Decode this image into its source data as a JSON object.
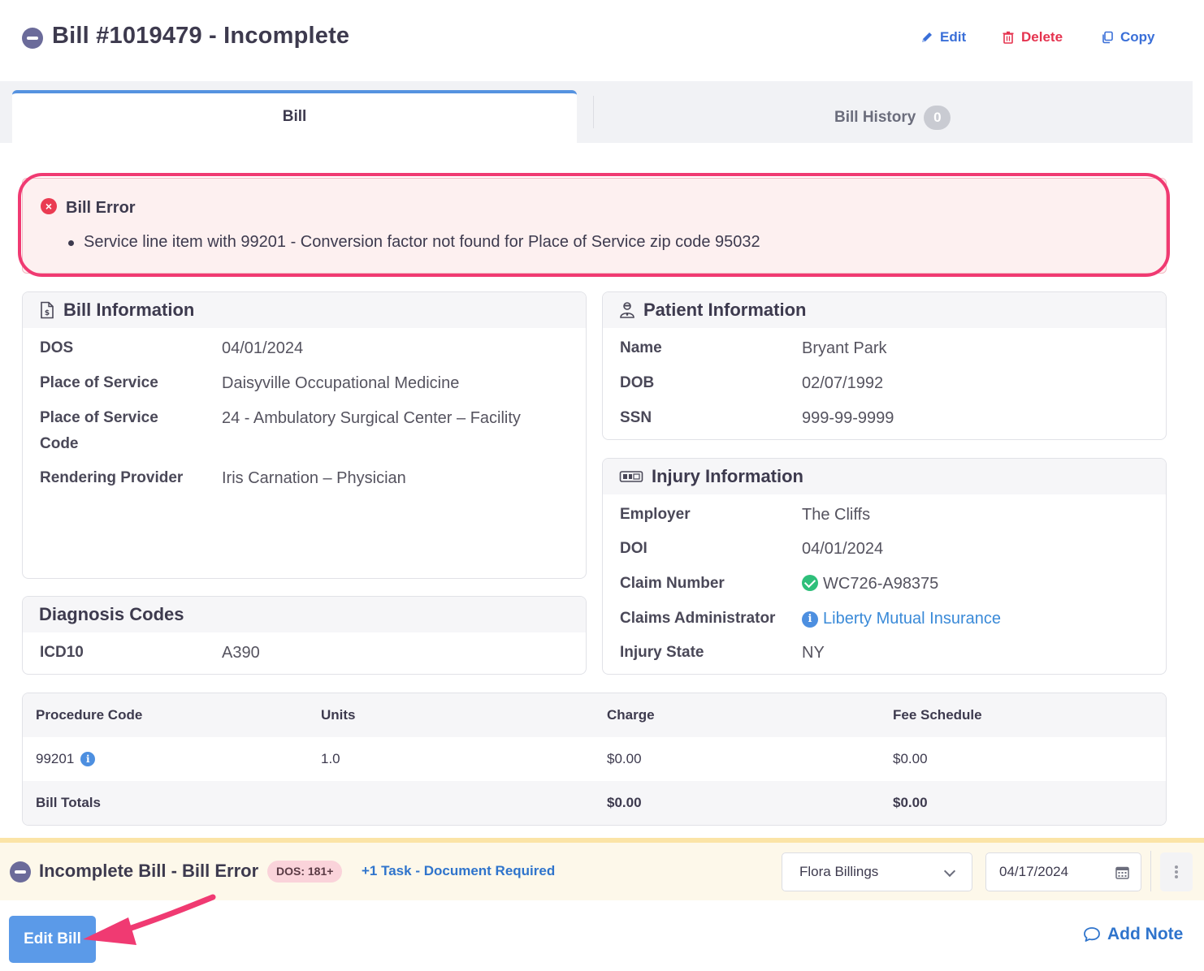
{
  "header": {
    "title": "Bill #1019479 - Incomplete",
    "actions": {
      "edit": "Edit",
      "delete": "Delete",
      "copy": "Copy"
    }
  },
  "tabs": {
    "bill": "Bill",
    "history": "Bill History",
    "history_count": "0"
  },
  "error": {
    "title": "Bill Error",
    "message": "Service line item with 99201 - Conversion factor not found for Place of Service zip code 95032"
  },
  "bill_info": {
    "title": "Bill Information",
    "rows": [
      {
        "label": "DOS",
        "value": "04/01/2024"
      },
      {
        "label": "Place of Service",
        "value": "Daisyville Occupational Medicine"
      },
      {
        "label": "Place of Service",
        "label2": "Code",
        "value": "24 - Ambulatory Surgical Center – Facility"
      },
      {
        "label": "Rendering Provider",
        "value": "Iris Carnation – Physician"
      }
    ]
  },
  "diagnosis": {
    "title": "Diagnosis Codes",
    "label": "ICD10",
    "value": "A390"
  },
  "patient_info": {
    "title": "Patient Information",
    "rows": [
      {
        "label": "Name",
        "value": "Bryant Park"
      },
      {
        "label": "DOB",
        "value": "02/07/1992"
      },
      {
        "label": "SSN",
        "value": "999-99-9999"
      }
    ]
  },
  "injury_info": {
    "title": "Injury Information",
    "rows": [
      {
        "label": "Employer",
        "value": "The Cliffs"
      },
      {
        "label": "DOI",
        "value": "04/01/2024"
      },
      {
        "label": "Claim Number",
        "value": "WC726-A98375"
      },
      {
        "label": "Claims Administrator",
        "value": "Liberty Mutual Insurance"
      },
      {
        "label": "Injury State",
        "value": "NY"
      }
    ]
  },
  "procedures": {
    "headers": [
      "Procedure Code",
      "Units",
      "Charge",
      "Fee Schedule"
    ],
    "row": {
      "code": "99201",
      "units": "1.0",
      "charge": "$0.00",
      "fee": "$0.00"
    },
    "totals": {
      "label": "Bill Totals",
      "charge": "$0.00",
      "fee": "$0.00"
    }
  },
  "status_bar": {
    "title": "Incomplete Bill - Bill Error",
    "dos_badge": "DOS: 181+",
    "task_link": "+1 Task - Document Required",
    "assignee": "Flora Billings",
    "date": "04/17/2024"
  },
  "footer": {
    "edit_bill": "Edit Bill",
    "add_note": "Add Note"
  },
  "colors": {
    "accent": "#5b9ae8",
    "link": "#2f74cc",
    "danger": "#e5334f",
    "highlight": "#f03a72"
  },
  "icons": [
    "minus-circle-icon",
    "pencil-icon",
    "trash-icon",
    "copy-icon",
    "error-x-icon",
    "bill-doc-icon",
    "patient-icon",
    "id-card-icon",
    "check-circle-icon",
    "info-icon",
    "calendar-icon",
    "kebab-icon",
    "chat-bubble-icon",
    "arrow-annotation"
  ]
}
